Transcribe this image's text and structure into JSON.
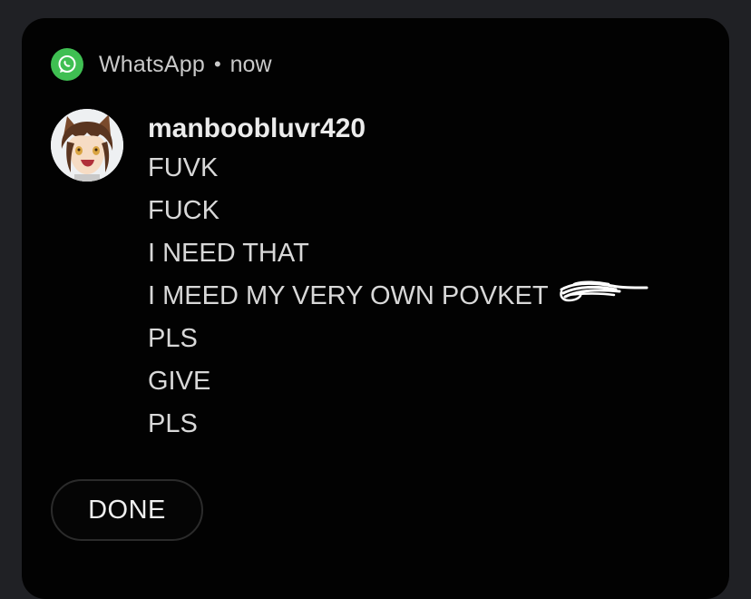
{
  "notification": {
    "app_name": "WhatsApp",
    "separator": "•",
    "time": "now",
    "app_icon": "whatsapp-icon",
    "sender": "manboobluvr420",
    "avatar_icon": "anime-character-avatar",
    "messages": [
      "FUVK",
      "FUCK",
      "I NEED THAT",
      "I MEED MY VERY OWN POVKET",
      "PLS",
      "GIVE",
      "PLS"
    ],
    "done_label": "DONE"
  },
  "colors": {
    "background": "#020202",
    "outer": "#202125",
    "whatsapp_green": "#3fbf52",
    "text_primary": "#ececec",
    "text_secondary": "#d8d8d8"
  }
}
